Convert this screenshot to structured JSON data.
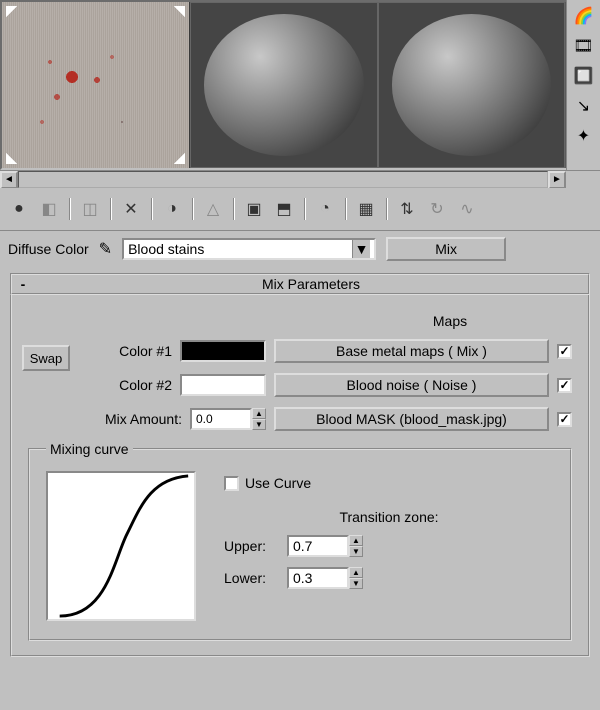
{
  "slot_label": "Diffuse Color",
  "material_name": "Blood stains",
  "type_button": "Mix",
  "rollout": {
    "title": "Mix Parameters"
  },
  "maps_header": "Maps",
  "swap": "Swap",
  "color1": {
    "label": "Color #1",
    "map": "Base metal maps  ( Mix )",
    "checked": true,
    "hex": "#000000"
  },
  "color2": {
    "label": "Color #2",
    "map": "Blood noise  ( Noise )",
    "checked": true,
    "hex": "#ffffff"
  },
  "mix_amount": {
    "label": "Mix Amount:",
    "value": "0.0",
    "map": "Blood MASK (blood_mask.jpg)",
    "checked": true
  },
  "curve": {
    "legend": "Mixing curve",
    "use_curve_label": "Use Curve",
    "use_curve": false,
    "zone_label": "Transition zone:",
    "upper_label": "Upper:",
    "upper": "0.7",
    "lower_label": "Lower:",
    "lower": "0.3"
  },
  "side": {
    "i1": "🌈",
    "i2": "🎞",
    "i3": "🔲",
    "i4": "↘",
    "i5": "✦"
  },
  "toolbar": {
    "t1": "●",
    "t2": "◧",
    "t3": "◫",
    "t4": "✕",
    "t5": "◑",
    "t6": "△",
    "t7": "▣",
    "t8": "⬒",
    "t9": "◔",
    "t10": "▦",
    "t11": "⇅",
    "t12": "↻",
    "t13": "∿"
  }
}
